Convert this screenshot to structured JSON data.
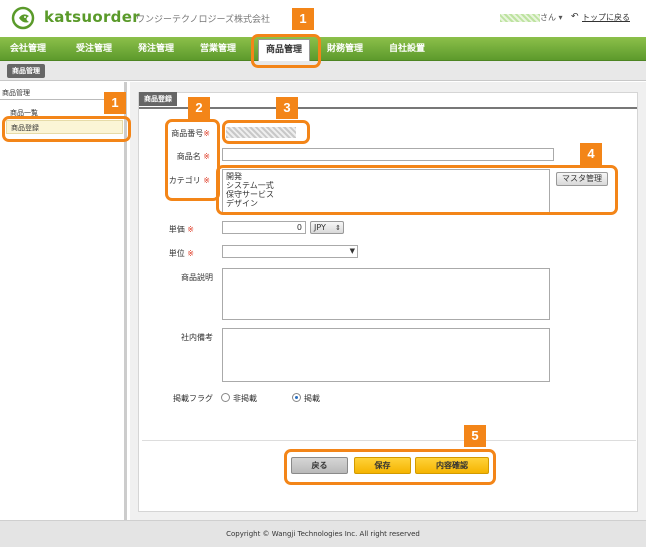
{
  "header": {
    "brand": "katsuorder",
    "company": "ワンジーテクノロジーズ株式会社",
    "user_suffix": "さん ▾",
    "top_link": "トップに戻る"
  },
  "nav": {
    "items": [
      "会社管理",
      "受注管理",
      "発注管理",
      "営業管理",
      "商品管理",
      "財務管理",
      "自社設置"
    ],
    "active": "商品管理"
  },
  "subbar": {
    "tab": "商品管理"
  },
  "sidebar": {
    "title": "商品管理",
    "items": [
      "商品一覧",
      "商品登録"
    ],
    "selected": "商品登録"
  },
  "panel": {
    "tab": "商品登録",
    "labels": {
      "product_no": "商品番号",
      "product_name": "商品名",
      "category": "カテゴリ",
      "unit_price": "単価",
      "unit": "単位",
      "description": "商品説明",
      "internal_note": "社内備考",
      "publish_flag": "掲載フラグ"
    },
    "required_mark": "※",
    "category_options": [
      "開発",
      "システム一式",
      "保守サービス",
      "デザイン"
    ],
    "master_button": "マスタ管理",
    "price_value": "0",
    "currency": "JPY",
    "publish_options": [
      "非掲載",
      "掲載"
    ],
    "publish_selected": "掲載"
  },
  "actions": {
    "back": "戻る",
    "save": "保存",
    "confirm": "内容確認"
  },
  "annotations": [
    "1",
    "1",
    "2",
    "3",
    "4",
    "5"
  ],
  "footer": "Copyright © Wangji Technologies Inc. All right reserved",
  "colors": {
    "nav_green": "#6aa834",
    "annotation_orange": "#f38518",
    "button_yellow": "#f5b400"
  }
}
